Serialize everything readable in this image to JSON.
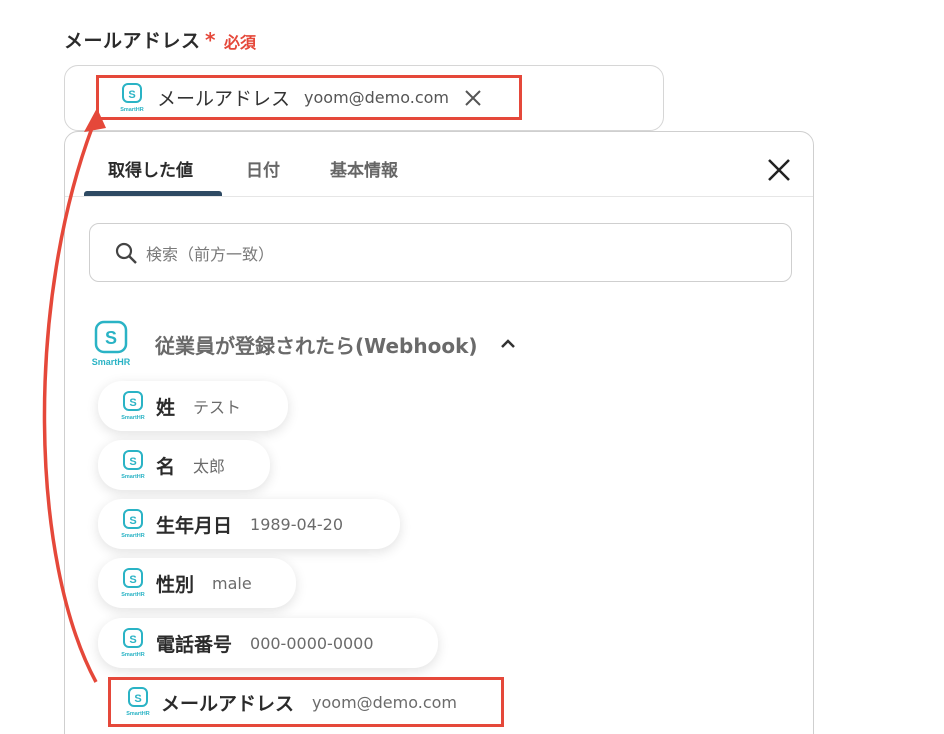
{
  "field": {
    "label": "メールアドレス",
    "required_star": "*",
    "required_text": "必須"
  },
  "selected_chip": {
    "key": "メールアドレス",
    "value": "yoom@demo.com"
  },
  "tabs": [
    {
      "label": "取得した値",
      "active": true
    },
    {
      "label": "日付",
      "active": false
    },
    {
      "label": "基本情報",
      "active": false
    }
  ],
  "search": {
    "placeholder": "検索（前方一致）"
  },
  "group": {
    "title": "従業員が登録されたら(Webhook)",
    "logo_text": "SmartHR"
  },
  "items": [
    {
      "key": "姓",
      "value": "テスト"
    },
    {
      "key": "名",
      "value": "太郎"
    },
    {
      "key": "生年月日",
      "value": "1989-04-20"
    },
    {
      "key": "性別",
      "value": "male"
    },
    {
      "key": "電話番号",
      "value": "000-0000-0000"
    },
    {
      "key": "メールアドレス",
      "value": "yoom@demo.com"
    }
  ],
  "colors": {
    "accent_red": "#e5483a",
    "smarthr_teal": "#2ab3c5",
    "tab_underline": "#2e4a63"
  },
  "icons": {
    "close": "close-icon",
    "search": "search-icon",
    "chevron": "chevron-up-icon",
    "logo": "smarthr-logo-icon"
  }
}
